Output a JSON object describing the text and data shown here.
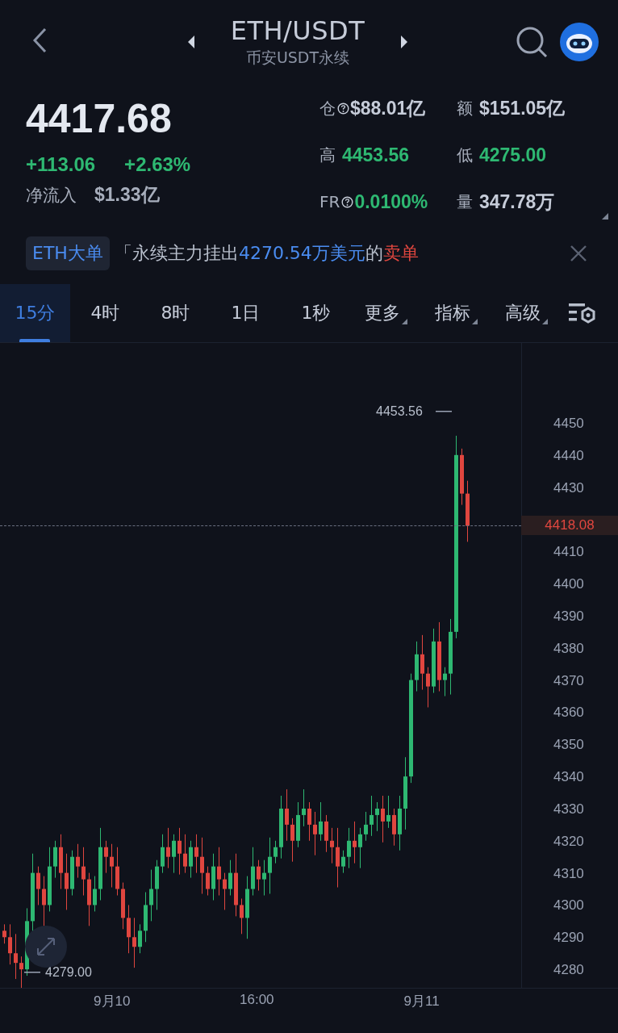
{
  "header": {
    "title": "ETH/USDT",
    "subtitle": "币安USDT永续"
  },
  "price": {
    "last": "4417.68",
    "change": "+113.06",
    "change_pct": "+2.63%",
    "inflow_label": "净流入",
    "inflow_value": "$1.33亿"
  },
  "stats": [
    {
      "label": "仓",
      "info": true,
      "value": "$88.01亿",
      "kind": "plain"
    },
    {
      "label": "额",
      "info": false,
      "value": "$151.05亿",
      "kind": "plain"
    },
    {
      "label": "高",
      "info": false,
      "value": "4453.56",
      "kind": "up"
    },
    {
      "label": "低",
      "info": false,
      "value": "4275.00",
      "kind": "up"
    },
    {
      "label": "FR",
      "info": true,
      "value": "0.0100%",
      "kind": "up"
    },
    {
      "label": "量",
      "info": false,
      "value": "347.78万",
      "kind": "plain"
    }
  ],
  "alert": {
    "tag": "ETH大单",
    "segments": [
      {
        "text": "「永续主力挂出",
        "kind": "plain"
      },
      {
        "text": "4270.54万美元",
        "kind": "amount"
      },
      {
        "text": "的",
        "kind": "plain"
      },
      {
        "text": "卖单",
        "kind": "sell"
      }
    ]
  },
  "tabs": [
    {
      "label": "15分",
      "selected": true,
      "menu": false
    },
    {
      "label": "4时",
      "selected": false,
      "menu": false
    },
    {
      "label": "8时",
      "selected": false,
      "menu": false
    },
    {
      "label": "1日",
      "selected": false,
      "menu": false
    },
    {
      "label": "1秒",
      "selected": false,
      "menu": false
    },
    {
      "label": "更多",
      "selected": false,
      "menu": true
    },
    {
      "label": "指标",
      "selected": false,
      "menu": true
    },
    {
      "label": "高级",
      "selected": false,
      "menu": true
    }
  ],
  "chart": {
    "high_label": "4453.56",
    "low_label": "4279.00",
    "current_price": "4418.08",
    "y_axis": [
      "4450",
      "4440",
      "4430",
      "4410",
      "4400",
      "4390",
      "4380",
      "4370",
      "4360",
      "4350",
      "4340",
      "4330",
      "4320",
      "4310",
      "4300",
      "4290",
      "4280"
    ],
    "x_axis": [
      "9月10",
      "16:00",
      "9月11"
    ]
  }
}
